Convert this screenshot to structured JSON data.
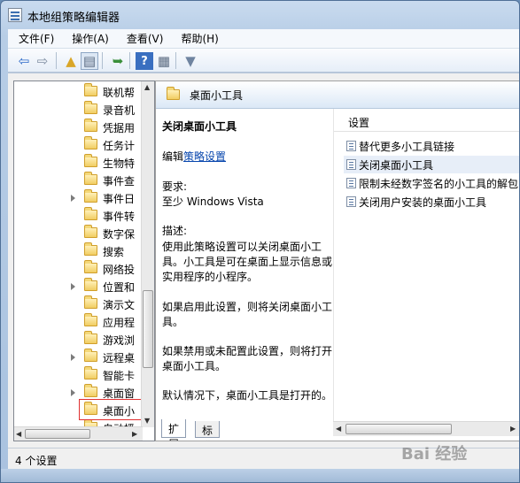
{
  "window": {
    "title": "本地组策略编辑器"
  },
  "menu": [
    {
      "label": "文件(F)"
    },
    {
      "label": "操作(A)"
    },
    {
      "label": "查看(V)"
    },
    {
      "label": "帮助(H)"
    }
  ],
  "toolbar": [
    {
      "name": "back-arrow-icon",
      "glyph": "⇦",
      "color": "#2a68c8"
    },
    {
      "name": "forward-arrow-icon",
      "glyph": "⇨",
      "color": "#7d8ca0"
    },
    {
      "name": "up-folder-icon",
      "glyph": "▲",
      "color": "#d9a628"
    },
    {
      "name": "show-hide-tree-icon",
      "glyph": "▤",
      "color": "#5a6a80"
    },
    {
      "name": "export-list-icon",
      "glyph": "➥",
      "color": "#3a8f3a"
    },
    {
      "name": "help-icon",
      "glyph": "?",
      "color": "#ffffff"
    },
    {
      "name": "properties-icon",
      "glyph": "▦",
      "color": "#5a6a80"
    },
    {
      "name": "filter-icon",
      "glyph": "▼",
      "color": "#6f84a0"
    }
  ],
  "tree": {
    "items": [
      {
        "label": "联机帮",
        "expander": false
      },
      {
        "label": "录音机",
        "expander": false
      },
      {
        "label": "凭据用",
        "expander": false
      },
      {
        "label": "任务计",
        "expander": false
      },
      {
        "label": "生物特",
        "expander": false
      },
      {
        "label": "事件查",
        "expander": false
      },
      {
        "label": "事件日",
        "expander": true
      },
      {
        "label": "事件转",
        "expander": false
      },
      {
        "label": "数字保",
        "expander": false
      },
      {
        "label": "搜索",
        "expander": false
      },
      {
        "label": "网络投",
        "expander": false
      },
      {
        "label": "位置和",
        "expander": true
      },
      {
        "label": "演示文",
        "expander": false
      },
      {
        "label": "应用程",
        "expander": false
      },
      {
        "label": "游戏浏",
        "expander": false
      },
      {
        "label": "远程桌",
        "expander": true
      },
      {
        "label": "智能卡",
        "expander": false
      },
      {
        "label": "桌面窗",
        "expander": true
      },
      {
        "label": "桌面小",
        "expander": false,
        "selected": true
      },
      {
        "label": "自动播",
        "expander": false
      }
    ]
  },
  "details": {
    "header": "桌面小工具",
    "description": {
      "title": "关闭桌面小工具",
      "edit_prefix": "编辑",
      "edit_link": "策略设置",
      "req_label": "要求:",
      "req_value": "至少 Windows Vista",
      "desc_label": "描述:",
      "para1": "使用此策略设置可以关闭桌面小工具。小工具是可在桌面上显示信息或实用程序的小程序。",
      "para2": "如果启用此设置，则将关闭桌面小工具。",
      "para3": "如果禁用或未配置此设置，则将打开桌面小工具。",
      "para4": "默认情况下，桌面小工具是打开的。"
    },
    "list": {
      "column": "设置",
      "items": [
        {
          "label": "替代更多小工具链接"
        },
        {
          "label": "关闭桌面小工具",
          "selected": true
        },
        {
          "label": "限制未经数字签名的小工具的解包"
        },
        {
          "label": "关闭用户安装的桌面小工具"
        }
      ]
    }
  },
  "tabs": [
    {
      "label": "扩展",
      "active": true
    },
    {
      "label": "标准",
      "active": false
    }
  ],
  "status": {
    "text": "4 个设置"
  },
  "watermark": "Bai 经验"
}
